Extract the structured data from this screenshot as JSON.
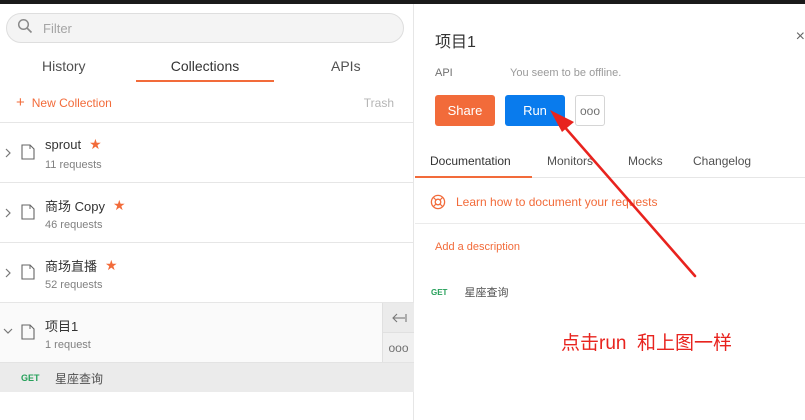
{
  "search": {
    "placeholder": "Filter"
  },
  "tabs": {
    "history": "History",
    "collections": "Collections",
    "apis": "APIs"
  },
  "actions": {
    "new_collection": "New Collection",
    "plus": "+",
    "trash": "Trash"
  },
  "collections": [
    {
      "name": "sprout",
      "count": "11 requests",
      "starred": true
    },
    {
      "name": "商场 Copy",
      "count": "46 requests",
      "starred": true
    },
    {
      "name": "商场直播",
      "count": "52 requests",
      "starred": true
    },
    {
      "name": "项目1",
      "count": "1 request",
      "starred": false
    }
  ],
  "expanded_request": {
    "method": "GET",
    "name": "星座查询"
  },
  "side_buttons": {
    "collapse": "⟵",
    "more": "ooo"
  },
  "panel": {
    "title": "项目1",
    "close": "×",
    "api_label": "API",
    "offline": "You seem to be offline.",
    "share": "Share",
    "run": "Run",
    "more": "ooo",
    "tabs": {
      "documentation": "Documentation",
      "monitors": "Monitors",
      "mocks": "Mocks",
      "changelog": "Changelog"
    },
    "learn": "Learn how to document your requests",
    "add_description": "Add a description",
    "request": {
      "method": "GET",
      "name": "星座查询"
    }
  },
  "annotation": {
    "text": "点击run  和上图一样",
    "color": "#e8231e"
  },
  "colors": {
    "accent": "#f26b3a",
    "run": "#097bed",
    "get": "#26a05a"
  }
}
